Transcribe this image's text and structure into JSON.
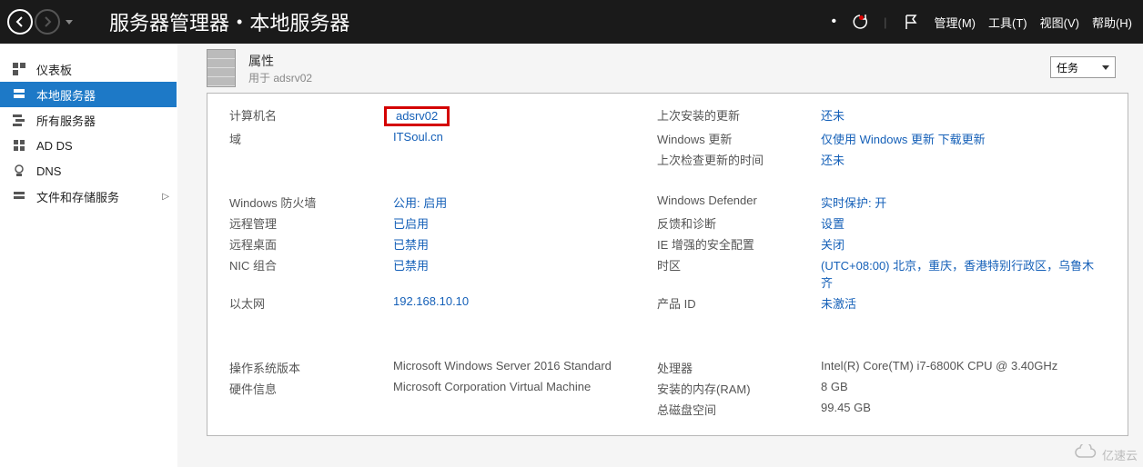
{
  "header": {
    "breadcrumb_root": "服务器管理器",
    "breadcrumb_current": "本地服务器",
    "refresh_bullet": "•",
    "menus": {
      "manage": "管理(M)",
      "tools": "工具(T)",
      "view": "视图(V)",
      "help": "帮助(H)"
    }
  },
  "sidebar": {
    "items": [
      {
        "label": "仪表板"
      },
      {
        "label": "本地服务器"
      },
      {
        "label": "所有服务器"
      },
      {
        "label": "AD DS"
      },
      {
        "label": "DNS"
      },
      {
        "label": "文件和存储服务"
      }
    ]
  },
  "props": {
    "title": "属性",
    "subtitle_prefix": "用于 ",
    "subtitle_hostname": "adsrv02",
    "tasks_label": "任务"
  },
  "fields": {
    "left1": [
      {
        "label": "计算机名",
        "value": "adsrv02",
        "highlighted": true
      },
      {
        "label": "域",
        "value": "ITSoul.cn"
      }
    ],
    "right1": [
      {
        "label": "上次安装的更新",
        "value": "还未"
      },
      {
        "label": "Windows 更新",
        "value": "仅使用 Windows 更新 下载更新"
      },
      {
        "label": "上次检查更新的时间",
        "value": "还未"
      }
    ],
    "left2": [
      {
        "label": "Windows 防火墙",
        "value": "公用: 启用"
      },
      {
        "label": "远程管理",
        "value": "已启用"
      },
      {
        "label": "远程桌面",
        "value": "已禁用"
      },
      {
        "label": "NIC 组合",
        "value": "已禁用"
      },
      {
        "label": "以太网",
        "value": "192.168.10.10"
      }
    ],
    "right2": [
      {
        "label": "Windows Defender",
        "value": "实时保护: 开"
      },
      {
        "label": "反馈和诊断",
        "value": "设置"
      },
      {
        "label": "IE 增强的安全配置",
        "value": "关闭"
      },
      {
        "label": "时区",
        "value": "(UTC+08:00) 北京，重庆，香港特别行政区，乌鲁木齐"
      },
      {
        "label": "产品 ID",
        "value": "未激活"
      }
    ],
    "left3": [
      {
        "label": "操作系统版本",
        "value": "Microsoft Windows Server 2016 Standard"
      },
      {
        "label": "硬件信息",
        "value": "Microsoft Corporation Virtual Machine"
      }
    ],
    "right3": [
      {
        "label": "处理器",
        "value": "Intel(R) Core(TM) i7-6800K CPU @ 3.40GHz"
      },
      {
        "label": "安装的内存(RAM)",
        "value": "8 GB"
      },
      {
        "label": "总磁盘空间",
        "value": "99.45 GB"
      }
    ]
  },
  "watermark": "亿速云"
}
